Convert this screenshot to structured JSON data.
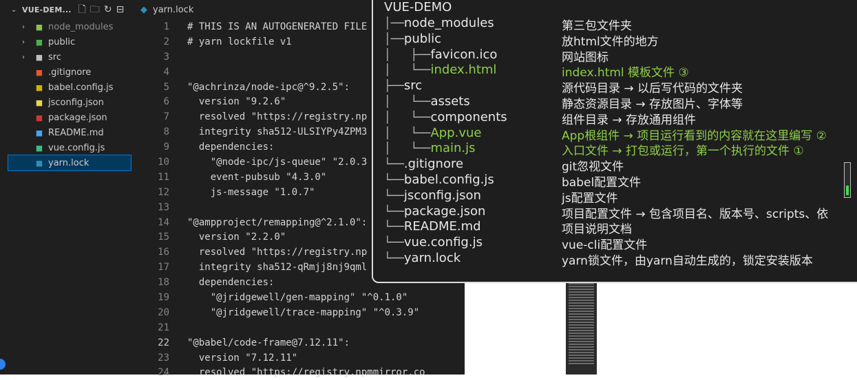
{
  "explorer": {
    "title": "VUE-DEM...",
    "items": [
      {
        "label": "node_modules",
        "chevron": "›",
        "icon": "node-icon",
        "icon_color": "#8bc34a",
        "muted": true
      },
      {
        "label": "public",
        "chevron": "›",
        "icon": "folder-icon",
        "icon_color": "#4caf50",
        "muted": false
      },
      {
        "label": "src",
        "chevron": "›",
        "icon": "folder-icon",
        "icon_color": "#c0c0c0",
        "muted": false
      },
      {
        "label": ".gitignore",
        "chevron": "",
        "icon": "git-icon",
        "icon_color": "#e4572e",
        "muted": false
      },
      {
        "label": "babel.config.js",
        "chevron": "",
        "icon": "babel-icon",
        "icon_color": "#d4b106",
        "muted": false
      },
      {
        "label": "jsconfig.json",
        "chevron": "",
        "icon": "js-icon",
        "icon_color": "#e8d44d",
        "muted": false
      },
      {
        "label": "package.json",
        "chevron": "",
        "icon": "npm-icon",
        "icon_color": "#cb3837",
        "muted": false
      },
      {
        "label": "README.md",
        "chevron": "",
        "icon": "readme-icon",
        "icon_color": "#42a5f5",
        "muted": false
      },
      {
        "label": "vue.config.js",
        "chevron": "",
        "icon": "vue-icon",
        "icon_color": "#41b883",
        "muted": false
      },
      {
        "label": "yarn.lock",
        "chevron": "",
        "icon": "yarn-icon",
        "icon_color": "#2c8ebb",
        "muted": false
      }
    ]
  },
  "editor": {
    "tab_label": "yarn.lock",
    "lines": [
      {
        "n": "1",
        "text": "# THIS IS AN AUTOGENERATED FILE",
        "cls": "txt"
      },
      {
        "n": "2",
        "text": "# yarn lockfile v1",
        "cls": "txt"
      },
      {
        "n": "3",
        "text": "",
        "cls": "txt"
      },
      {
        "n": "4",
        "text": "",
        "cls": "txt"
      },
      {
        "n": "5",
        "text": "\"@achrinza/node-ipc@^9.2.5\":",
        "cls": "txt"
      },
      {
        "n": "6",
        "text": "  version \"9.2.6\"",
        "cls": "txt"
      },
      {
        "n": "7",
        "text": "  resolved \"https://registry.np",
        "cls": "txt"
      },
      {
        "n": "8",
        "text": "  integrity sha512-ULSIYPy4ZPM3",
        "cls": "txt"
      },
      {
        "n": "9",
        "text": "  dependencies:",
        "cls": "txt"
      },
      {
        "n": "10",
        "text": "    \"@node-ipc/js-queue\" \"2.0.3",
        "cls": "txt"
      },
      {
        "n": "11",
        "text": "    event-pubsub \"4.3.0\"",
        "cls": "txt"
      },
      {
        "n": "12",
        "text": "    js-message \"1.0.7\"",
        "cls": "txt"
      },
      {
        "n": "13",
        "text": "",
        "cls": "txt"
      },
      {
        "n": "14",
        "text": "\"@ampproject/remapping@^2.1.0\":",
        "cls": "txt"
      },
      {
        "n": "15",
        "text": "  version \"2.2.0\"",
        "cls": "txt"
      },
      {
        "n": "16",
        "text": "  resolved \"https://registry.np",
        "cls": "txt"
      },
      {
        "n": "17",
        "text": "  integrity sha512-qRmjj8nj9qml",
        "cls": "txt"
      },
      {
        "n": "18",
        "text": "  dependencies:",
        "cls": "txt"
      },
      {
        "n": "19",
        "text": "    \"@jridgewell/gen-mapping\" \"^0.1.0\"",
        "cls": "txt"
      },
      {
        "n": "20",
        "text": "    \"@jridgewell/trace-mapping\" \"^0.3.9\"",
        "cls": "txt"
      },
      {
        "n": "21",
        "text": "",
        "cls": "txt"
      },
      {
        "n": "22",
        "text": "\"@babel/code-frame@7.12.11\":",
        "cls": "txt"
      },
      {
        "n": "23",
        "text": "  version \"7.12.11\"",
        "cls": "txt"
      },
      {
        "n": "24",
        "text": "  resolved \"https://registry.npmmirror.co",
        "cls": "txt"
      }
    ]
  },
  "overlay": {
    "title": "VUE-DEMO",
    "rows": [
      {
        "tree": "│──",
        "name": "node_modules",
        "desc": "第三包文件夹",
        "green": false
      },
      {
        "tree": "│──",
        "name": "public",
        "desc": "放html文件的地方",
        "green": false
      },
      {
        "tree": "│   ├──",
        "name": "favicon.ico",
        "desc": "网站图标",
        "green": false
      },
      {
        "tree": "│   └──",
        "name": "index.html",
        "desc": "index.html 模板文件 ③",
        "green": true
      },
      {
        "tree": "├──",
        "name": "src",
        "desc": "源代码目录 → 以后写代码的文件夹",
        "green": false
      },
      {
        "tree": "│   └──",
        "name": "assets",
        "desc": "静态资源目录 → 存放图片、字体等",
        "green": false
      },
      {
        "tree": "│   └──",
        "name": "components",
        "desc": "组件目录 → 存放通用组件",
        "green": false
      },
      {
        "tree": "│   └──",
        "name": "App.vue",
        "desc": "App根组件 → 项目运行看到的内容就在这里编写 ②",
        "green": true
      },
      {
        "tree": "│   └──",
        "name": "main.js",
        "desc": "入口文件 → 打包或运行，第一个执行的文件 ①",
        "green": true
      },
      {
        "tree": "└──",
        "name": ".gitignore",
        "desc": "git忽视文件",
        "green": false
      },
      {
        "tree": "└──",
        "name": "babel.config.js",
        "desc": "babel配置文件",
        "green": false
      },
      {
        "tree": "└──",
        "name": "jsconfig.json",
        "desc": "js配置文件",
        "green": false
      },
      {
        "tree": "└──",
        "name": "package.json",
        "desc": "项目配置文件 → 包含项目名、版本号、scripts、依",
        "green": false
      },
      {
        "tree": "└──",
        "name": "README.md",
        "desc": "项目说明文档",
        "green": false
      },
      {
        "tree": "└──",
        "name": "vue.config.js",
        "desc": "vue-cli配置文件",
        "green": false
      },
      {
        "tree": "└──",
        "name": "yarn.lock",
        "desc": "yarn锁文件，由yarn自动生成的，锁定安装版本",
        "green": false
      }
    ]
  }
}
